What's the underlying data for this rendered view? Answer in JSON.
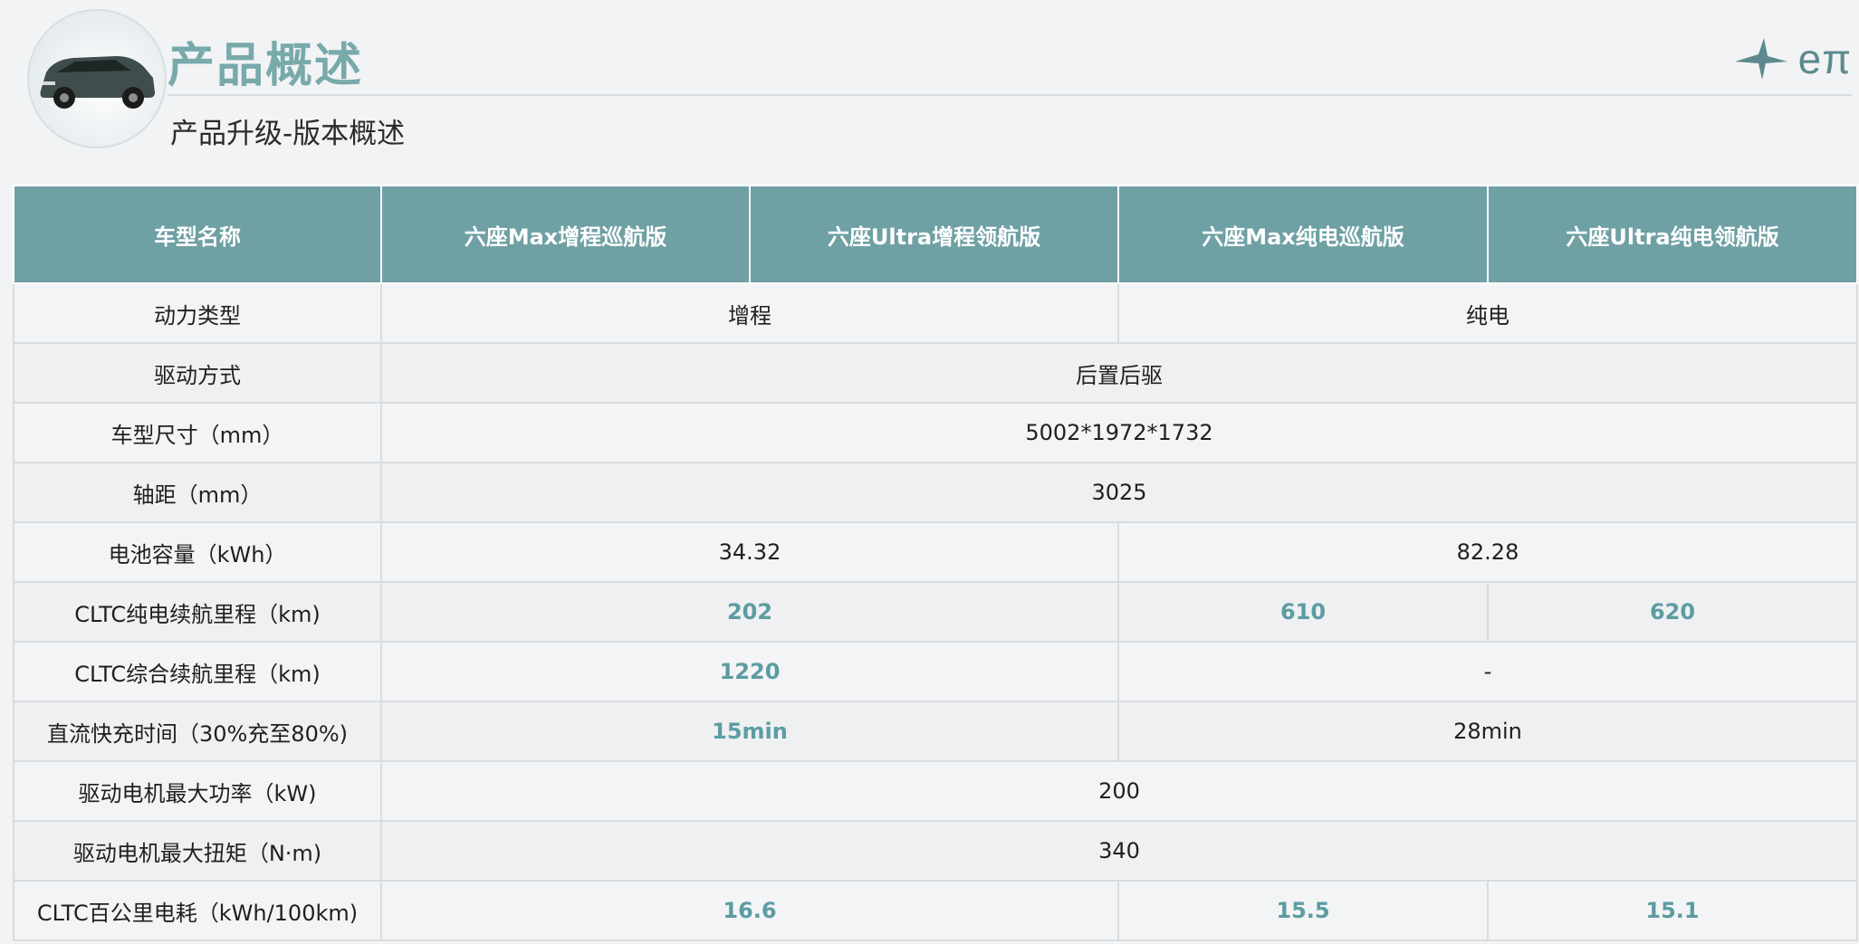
{
  "header": {
    "title": "产品概述",
    "subtitle": "产品升级-版本概述",
    "brand": "eπ",
    "car_image": "suv-car-image",
    "brand_logo": "ept-logo-icon"
  },
  "colors": {
    "accent": "#6fa0a4",
    "title": "#78a9ab",
    "highlight_value": "#5c9ca2"
  },
  "table": {
    "columns": [
      "车型名称",
      "六座Max增程巡航版",
      "六座Ultra增程领航版",
      "六座Max纯电巡航版",
      "六座Ultra纯电领航版"
    ],
    "rows": [
      {
        "label": "动力类型",
        "cells": [
          {
            "text": "增程",
            "span": 2
          },
          {
            "text": "纯电",
            "span": 2
          }
        ]
      },
      {
        "label": "驱动方式",
        "cells": [
          {
            "text": "后置后驱",
            "span": 4
          }
        ]
      },
      {
        "label": "车型尺寸（mm）",
        "cells": [
          {
            "text": "5002*1972*1732",
            "span": 4
          }
        ]
      },
      {
        "label": "轴距（mm）",
        "cells": [
          {
            "text": "3025",
            "span": 4
          }
        ]
      },
      {
        "label": "电池容量（kWh）",
        "cells": [
          {
            "text": "34.32",
            "span": 2
          },
          {
            "text": "82.28",
            "span": 2
          }
        ]
      },
      {
        "label": "CLTC纯电续航里程（km)",
        "cells": [
          {
            "text": "202",
            "span": 2,
            "hl": true
          },
          {
            "text": "610",
            "span": 1,
            "hl": true
          },
          {
            "text": "620",
            "span": 1,
            "hl": true
          }
        ]
      },
      {
        "label": "CLTC综合续航里程（km)",
        "cells": [
          {
            "text": "1220",
            "span": 2,
            "hl": true
          },
          {
            "text": "-",
            "span": 2
          }
        ]
      },
      {
        "label": "直流快充时间（30%充至80%)",
        "cells": [
          {
            "text": "15min",
            "span": 2,
            "hl": true
          },
          {
            "text": "28min",
            "span": 2
          }
        ]
      },
      {
        "label": "驱动电机最大功率（kW)",
        "cells": [
          {
            "text": "200",
            "span": 4
          }
        ]
      },
      {
        "label": "驱动电机最大扭矩（N·m)",
        "cells": [
          {
            "text": "340",
            "span": 4
          }
        ]
      },
      {
        "label": "CLTC百公里电耗（kWh/100km)",
        "cells": [
          {
            "text": "16.6",
            "span": 2,
            "hl": true
          },
          {
            "text": "15.5",
            "span": 1,
            "hl": true
          },
          {
            "text": "15.1",
            "span": 1,
            "hl": true
          }
        ]
      }
    ]
  }
}
